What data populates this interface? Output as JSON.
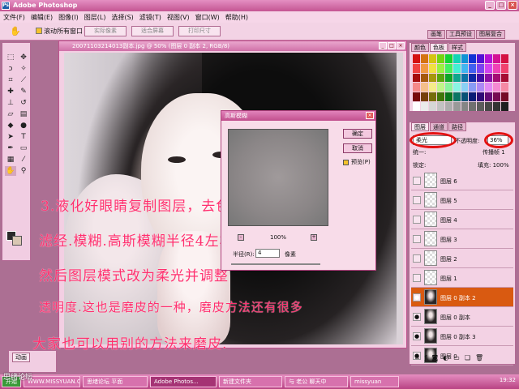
{
  "window": {
    "title": "Adobe Photoshop"
  },
  "menu": [
    "文件(F)",
    "编辑(E)",
    "图像(I)",
    "图层(L)",
    "选择(S)",
    "滤镜(T)",
    "视图(V)",
    "窗口(W)",
    "帮助(H)"
  ],
  "options": {
    "scroll_all_label": "滚动所有窗口",
    "buttons": [
      "实际像素",
      "适合屏幕",
      "打印尺寸"
    ]
  },
  "panel_well_tabs": [
    "画笔",
    "工具预设",
    "图层复合"
  ],
  "document": {
    "title": "20071103214013副本.jpg @ 50% (图层 0 副本 2, RGB/8)"
  },
  "overlay_text": [
    "3.液化好眼睛复制图层，去色",
    "滤经.模糊.高斯模糊半径4左右",
    "然后图层模式改为柔光并调整",
    "透明度.这也是磨皮的一种，磨皮方法还有很多",
    "大家也可以用别的方法来磨皮."
  ],
  "gaussian_dialog": {
    "title": "高斯模糊",
    "ok": "确定",
    "cancel": "取消",
    "preview_label": "预览(P)",
    "zoom_percent": "100%",
    "radius_label": "半径(R):",
    "radius_value": "4",
    "radius_unit": "像素"
  },
  "color_panel": {
    "tabs": [
      "颜色",
      "色板",
      "样式"
    ]
  },
  "layers_panel": {
    "tabs": [
      "图层",
      "通道",
      "路径"
    ],
    "blend_mode": "柔光",
    "opacity_label": "不透明度:",
    "opacity_value": "36%",
    "unify_label": "统一:",
    "spread_label": "传播帧 1",
    "lock_label": "锁定:",
    "fill_label": "填充:",
    "fill_value": "100%",
    "layers": [
      {
        "name": "图层 6",
        "thumb": "transparent",
        "visible": false,
        "active": false
      },
      {
        "name": "图层 5",
        "thumb": "transparent",
        "visible": false,
        "active": false
      },
      {
        "name": "图层 4",
        "thumb": "transparent",
        "visible": false,
        "active": false
      },
      {
        "name": "图层 3",
        "thumb": "transparent",
        "visible": false,
        "active": false
      },
      {
        "name": "图层 2",
        "thumb": "transparent",
        "visible": false,
        "active": false
      },
      {
        "name": "图层 1",
        "thumb": "transparent",
        "visible": false,
        "active": false
      },
      {
        "name": "图层 0 副本 2",
        "thumb": "photo",
        "visible": true,
        "active": true
      },
      {
        "name": "图层 0 副本",
        "thumb": "photo",
        "visible": true,
        "active": false
      },
      {
        "name": "图层 0 副本 3",
        "thumb": "photo",
        "visible": true,
        "active": false
      },
      {
        "name": "图层 0",
        "thumb": "photo",
        "visible": true,
        "active": false
      }
    ]
  },
  "animation_panel": {
    "tab": "动画"
  },
  "taskbar": {
    "items": [
      "开始",
      "WWW.MISSYUAN.COM",
      "思绪论坛 平面",
      "Adobe Photos...",
      "新建文件夹",
      "与 老公 聊天中",
      "missyuan"
    ],
    "time": "19:32"
  },
  "watermark": "思绪论坛"
}
